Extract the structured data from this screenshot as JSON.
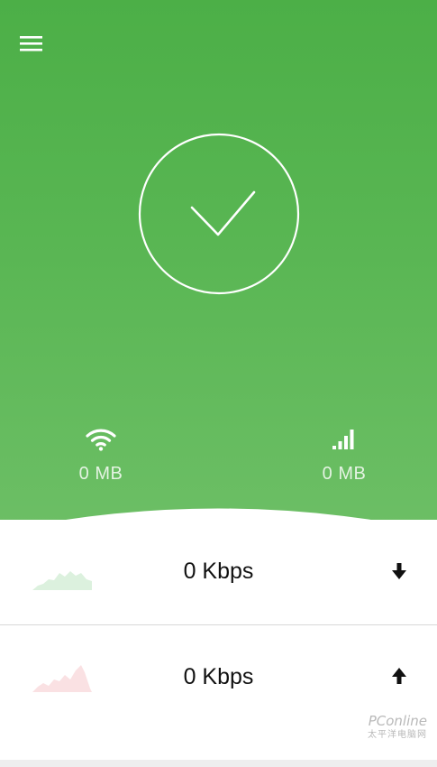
{
  "stats": {
    "wifi": {
      "icon": "wifi-icon",
      "value": "0 MB"
    },
    "cellular": {
      "icon": "cellular-signal-icon",
      "value": "0 MB"
    }
  },
  "status": {
    "icon": "checkmark-icon"
  },
  "speeds": {
    "download": {
      "value": "0 Kbps",
      "icon": "arrow-down-icon",
      "graph_color": "#3cb44a"
    },
    "upload": {
      "value": "0 Kbps",
      "icon": "arrow-up-icon",
      "graph_color": "#e0454f"
    }
  },
  "watermark": {
    "main": "PConline",
    "sub": "太平洋电脑网"
  },
  "colors": {
    "accent": "#4caf47",
    "hero_bottom": "#6dbf66"
  }
}
